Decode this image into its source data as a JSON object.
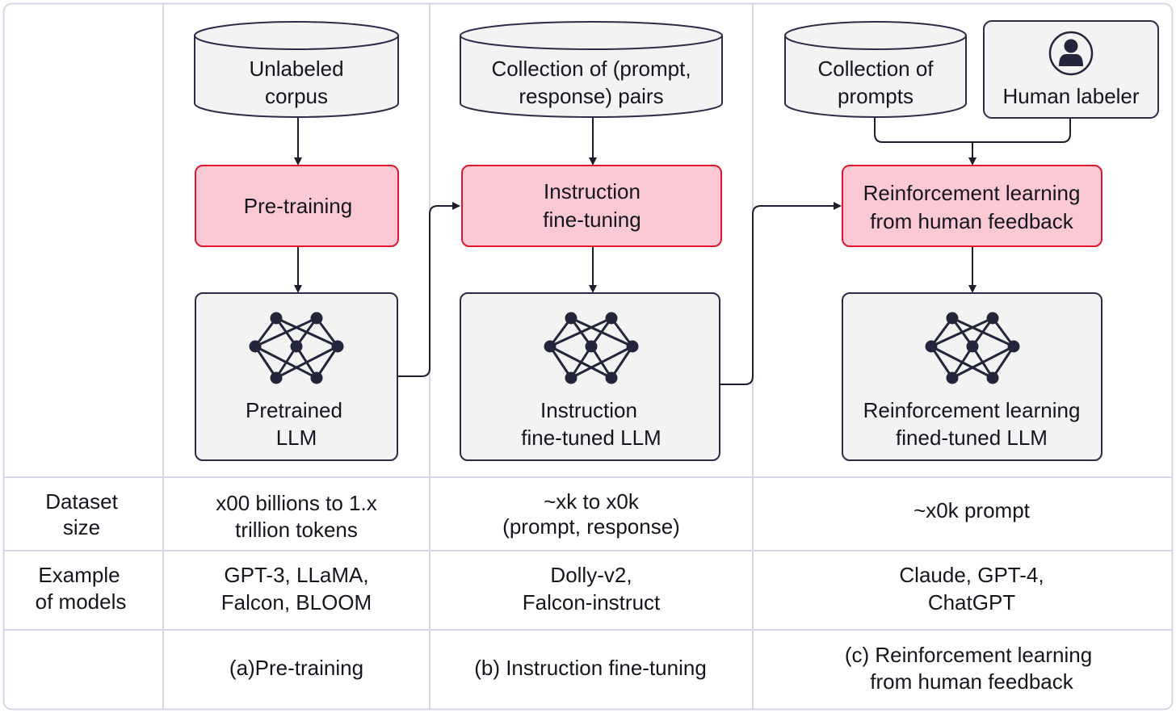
{
  "colors": {
    "frame_border": "#d6d6e8",
    "node_stroke": "#2b2d48",
    "node_fill": "#f3f3f4",
    "stage_fill": "#fac9d3",
    "stage_stroke": "#e0182d",
    "arrow": "#1c1e2e",
    "icon": "#23263a",
    "text": "#15151f"
  },
  "columns": [
    {
      "id": "pretraining",
      "data_source": {
        "lines": [
          "Unlabeled",
          "corpus"
        ],
        "shape": "cylinder"
      },
      "stage": {
        "lines": [
          "Pre-training"
        ]
      },
      "model": {
        "lines": [
          "Pretrained",
          "LLM"
        ],
        "icon": "neural-network-icon"
      },
      "dataset_size": [
        "x00 billions to 1.x",
        "trillion tokens"
      ],
      "example_models": [
        "GPT-3, LLaMA,",
        "Falcon, BLOOM"
      ],
      "caption": [
        "(a)Pre-training"
      ]
    },
    {
      "id": "instruction-fine-tuning",
      "data_source": {
        "lines": [
          "Collection of (prompt,",
          "response) pairs"
        ],
        "shape": "cylinder"
      },
      "stage": {
        "lines": [
          "Instruction",
          "fine-tuning"
        ]
      },
      "model": {
        "lines": [
          "Instruction",
          "fine-tuned LLM"
        ],
        "icon": "neural-network-icon"
      },
      "dataset_size": [
        "~xk to x0k",
        "(prompt, response)"
      ],
      "example_models": [
        "Dolly-v2,",
        "Falcon-instruct"
      ],
      "caption": [
        "(b) Instruction fine-tuning"
      ]
    },
    {
      "id": "rlhf",
      "data_source": {
        "lines": [
          "Collection of",
          "prompts"
        ],
        "shape": "cylinder"
      },
      "human_labeler": {
        "lines": [
          "Human labeler"
        ],
        "icon": "user-icon"
      },
      "stage": {
        "lines": [
          "Reinforcement learning",
          "from human feedback"
        ]
      },
      "model": {
        "lines": [
          "Reinforcement learning",
          "fined-tuned LLM"
        ],
        "icon": "neural-network-icon"
      },
      "dataset_size": [
        "~x0k prompt"
      ],
      "example_models": [
        "Claude, GPT-4,",
        "ChatGPT"
      ],
      "caption": [
        "(c) Reinforcement learning",
        "from human feedback"
      ]
    }
  ],
  "row_headers": {
    "dataset_size": [
      "Dataset",
      "size"
    ],
    "example_models": [
      "Example",
      "of models"
    ],
    "caption": []
  }
}
